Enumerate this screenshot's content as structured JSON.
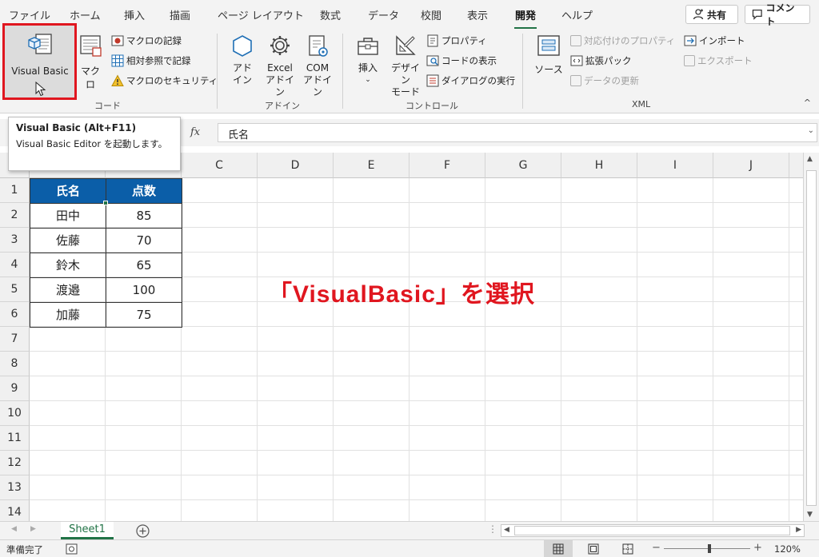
{
  "tabs": [
    "ファイル",
    "ホーム",
    "挿入",
    "描画",
    "ページ レイアウト",
    "数式",
    "データ",
    "校閲",
    "表示",
    "開発",
    "ヘルプ"
  ],
  "active_tab": "開発",
  "top_buttons": {
    "share": "共有",
    "comment": "コメント"
  },
  "ribbon": {
    "code": {
      "label": "コード",
      "visual_basic": "Visual Basic",
      "macro": "マクロ",
      "record_macro": "マクロの記録",
      "relative_ref": "相対参照で記録",
      "macro_security": "マクロのセキュリティ"
    },
    "addin": {
      "label": "アドイン",
      "addin_line1": "アド",
      "addin_line2": "イン",
      "excel_line1": "Excel",
      "excel_line2": "アドイン",
      "com_line1": "COM",
      "com_line2": "アドイン"
    },
    "controls": {
      "label": "コントロール",
      "insert": "挿入",
      "design_line1": "デザイン",
      "design_line2": "モード",
      "properties": "プロパティ",
      "view_code": "コードの表示",
      "run_dialog": "ダイアログの実行"
    },
    "xml": {
      "label": "XML",
      "source": "ソース",
      "map_props": "対応付けのプロパティ",
      "expansion_pack": "拡張パック",
      "refresh_data": "データの更新",
      "import": "インポート",
      "export": "エクスポート"
    }
  },
  "tooltip": {
    "title": "Visual Basic (Alt+F11)",
    "description": "Visual Basic Editor を起動します。"
  },
  "formula_bar": {
    "fx": "fx",
    "content": "氏名"
  },
  "columns": [
    "C",
    "D",
    "E",
    "F",
    "G",
    "H",
    "I",
    "J"
  ],
  "rows": [
    "1",
    "2",
    "3",
    "4",
    "5",
    "6",
    "7",
    "8",
    "9",
    "10",
    "11",
    "12",
    "13",
    "14"
  ],
  "table": {
    "headers": [
      "氏名",
      "点数"
    ],
    "rows": [
      [
        "田中",
        "85"
      ],
      [
        "佐藤",
        "70"
      ],
      [
        "鈴木",
        "65"
      ],
      [
        "渡邉",
        "100"
      ],
      [
        "加藤",
        "75"
      ]
    ]
  },
  "annotation": "「VisualBasic」を選択",
  "sheet_tab": "Sheet1",
  "status": {
    "ready": "準備完了",
    "zoom": "120%"
  },
  "colors": {
    "accent": "#217346",
    "highlight": "#e0161f",
    "table_header": "#0b5ea8"
  }
}
